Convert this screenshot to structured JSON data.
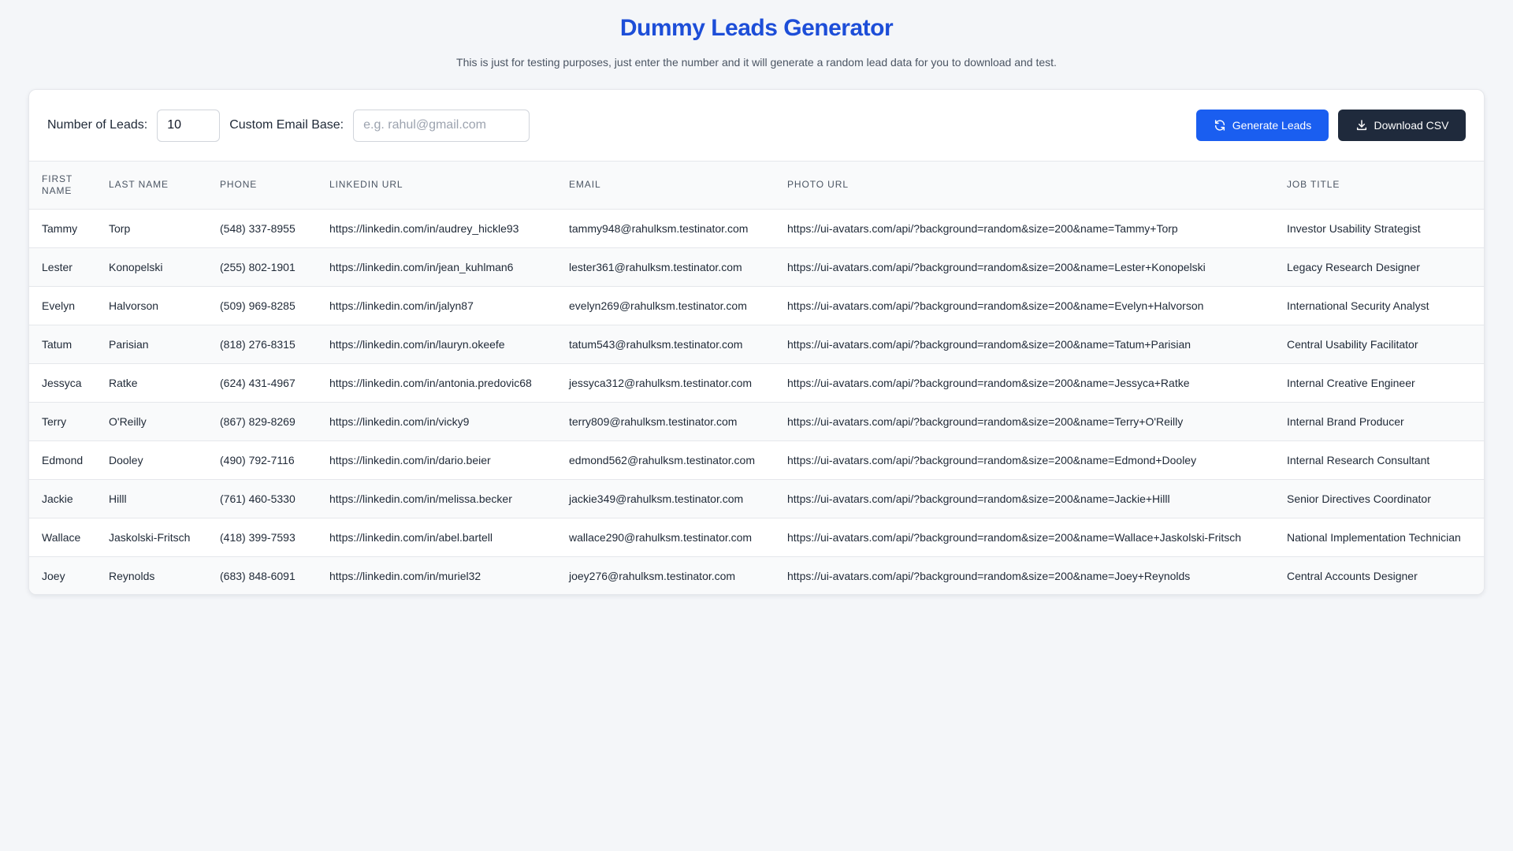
{
  "header": {
    "title": "Dummy Leads Generator",
    "subtitle": "This is just for testing purposes, just enter the number and it will generate a random lead data for you to download and test."
  },
  "controls": {
    "num_leads_label": "Number of Leads:",
    "num_leads_value": "10",
    "email_base_label": "Custom Email Base:",
    "email_base_placeholder": "e.g. rahul@gmail.com",
    "email_base_value": "",
    "generate_label": "Generate Leads",
    "download_label": "Download CSV"
  },
  "table": {
    "columns": [
      "First Name",
      "Last Name",
      "Phone",
      "LinkedIn URL",
      "Email",
      "Photo URL",
      "Job Title"
    ],
    "rows": [
      [
        "Tammy",
        "Torp",
        "(548) 337-8955",
        "https://linkedin.com/in/audrey_hickle93",
        "tammy948@rahulksm.testinator.com",
        "https://ui-avatars.com/api/?background=random&size=200&name=Tammy+Torp",
        "Investor Usability Strategist"
      ],
      [
        "Lester",
        "Konopelski",
        "(255) 802-1901",
        "https://linkedin.com/in/jean_kuhlman6",
        "lester361@rahulksm.testinator.com",
        "https://ui-avatars.com/api/?background=random&size=200&name=Lester+Konopelski",
        "Legacy Research Designer"
      ],
      [
        "Evelyn",
        "Halvorson",
        "(509) 969-8285",
        "https://linkedin.com/in/jalyn87",
        "evelyn269@rahulksm.testinator.com",
        "https://ui-avatars.com/api/?background=random&size=200&name=Evelyn+Halvorson",
        "International Security Analyst"
      ],
      [
        "Tatum",
        "Parisian",
        "(818) 276-8315",
        "https://linkedin.com/in/lauryn.okeefe",
        "tatum543@rahulksm.testinator.com",
        "https://ui-avatars.com/api/?background=random&size=200&name=Tatum+Parisian",
        "Central Usability Facilitator"
      ],
      [
        "Jessyca",
        "Ratke",
        "(624) 431-4967",
        "https://linkedin.com/in/antonia.predovic68",
        "jessyca312@rahulksm.testinator.com",
        "https://ui-avatars.com/api/?background=random&size=200&name=Jessyca+Ratke",
        "Internal Creative Engineer"
      ],
      [
        "Terry",
        "O'Reilly",
        "(867) 829-8269",
        "https://linkedin.com/in/vicky9",
        "terry809@rahulksm.testinator.com",
        "https://ui-avatars.com/api/?background=random&size=200&name=Terry+O'Reilly",
        "Internal Brand Producer"
      ],
      [
        "Edmond",
        "Dooley",
        "(490) 792-7116",
        "https://linkedin.com/in/dario.beier",
        "edmond562@rahulksm.testinator.com",
        "https://ui-avatars.com/api/?background=random&size=200&name=Edmond+Dooley",
        "Internal Research Consultant"
      ],
      [
        "Jackie",
        "Hilll",
        "(761) 460-5330",
        "https://linkedin.com/in/melissa.becker",
        "jackie349@rahulksm.testinator.com",
        "https://ui-avatars.com/api/?background=random&size=200&name=Jackie+Hilll",
        "Senior Directives Coordinator"
      ],
      [
        "Wallace",
        "Jaskolski-Fritsch",
        "(418) 399-7593",
        "https://linkedin.com/in/abel.bartell",
        "wallace290@rahulksm.testinator.com",
        "https://ui-avatars.com/api/?background=random&size=200&name=Wallace+Jaskolski-Fritsch",
        "National Implementation Technician"
      ],
      [
        "Joey",
        "Reynolds",
        "(683) 848-6091",
        "https://linkedin.com/in/muriel32",
        "joey276@rahulksm.testinator.com",
        "https://ui-avatars.com/api/?background=random&size=200&name=Joey+Reynolds",
        "Central Accounts Designer"
      ]
    ]
  },
  "icons": {
    "generate": "refresh-icon",
    "download": "download-icon"
  },
  "colors": {
    "title": "#1d4ed8",
    "primary_button": "#1a5ef0",
    "dark_button": "#1f2a3c",
    "page_background": "#f4f6f9"
  }
}
